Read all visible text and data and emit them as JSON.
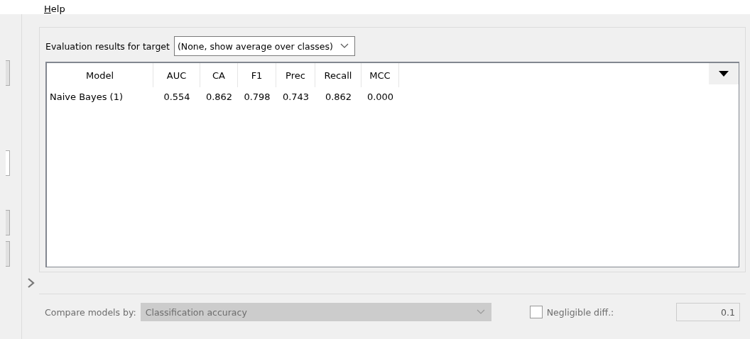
{
  "menu": [
    {
      "label": "Help"
    }
  ],
  "target": {
    "label": "Evaluation results for target",
    "value": "(None, show average over classes)"
  },
  "table": {
    "columns": [
      "Model",
      "AUC",
      "CA",
      "F1",
      "Prec",
      "Recall",
      "MCC"
    ],
    "rows": [
      [
        "Naive Bayes (1)",
        "0.554",
        "0.862",
        "0.798",
        "0.743",
        "0.862",
        "0.000"
      ]
    ]
  },
  "compare": {
    "label": "Compare models by:",
    "value": "Classification accuracy",
    "disabled": true
  },
  "negligible": {
    "label": "Negligible diff.:",
    "checked": false,
    "value": "0.1"
  }
}
